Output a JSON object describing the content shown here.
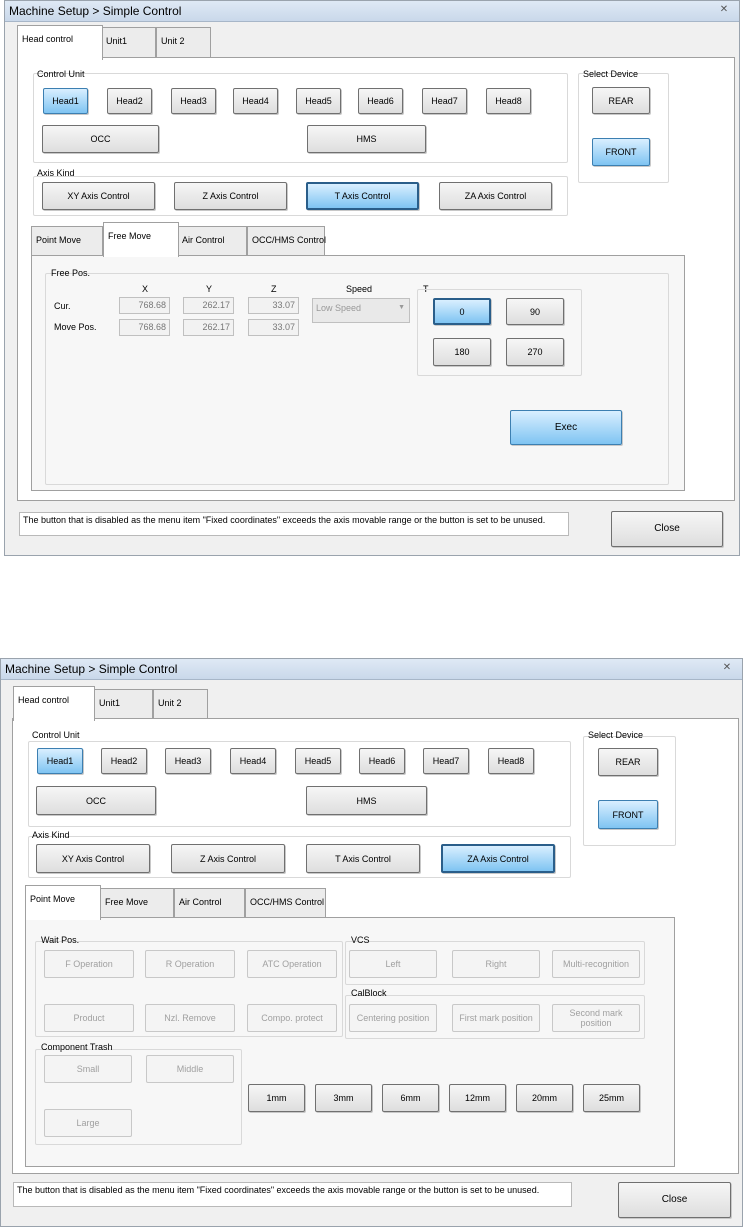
{
  "window1": {
    "title": "Machine Setup > Simple Control",
    "main_tabs": [
      "Head control",
      "Unit1",
      "Unit 2"
    ],
    "control_unit": {
      "label": "Control Unit",
      "heads": [
        "Head1",
        "Head2",
        "Head3",
        "Head4",
        "Head5",
        "Head6",
        "Head7",
        "Head8"
      ],
      "occ": "OCC",
      "hms": "HMS"
    },
    "select_device": {
      "label": "Select Device",
      "rear": "REAR",
      "front": "FRONT"
    },
    "axis_kind": {
      "label": "Axis Kind",
      "buttons": [
        "XY Axis Control",
        "Z Axis Control",
        "T Axis Control",
        "ZA Axis Control"
      ],
      "selected": "T Axis Control"
    },
    "sub_tabs": [
      "Point Move",
      "Free Move",
      "Air Control",
      "OCC/HMS Control"
    ],
    "active_sub_tab": "Free Move",
    "free_pos": {
      "label": "Free Pos.",
      "col_x": "X",
      "col_y": "Y",
      "col_z": "Z",
      "col_speed": "Speed",
      "col_t": "T",
      "row_cur": "Cur.",
      "row_move": "Move Pos.",
      "cur_x": "768.68",
      "cur_y": "262.17",
      "cur_z": "33.07",
      "move_x": "768.68",
      "move_y": "262.17",
      "move_z": "33.07",
      "speed": "Low Speed",
      "t_buttons": [
        "0",
        "90",
        "180",
        "270"
      ],
      "t_selected": "0"
    },
    "exec": "Exec",
    "status_text": "The button that is disabled as the menu item \"Fixed coordinates\" exceeds the axis movable range or the button is set to be unused.",
    "close": "Close"
  },
  "window2": {
    "title": "Machine Setup > Simple Control",
    "main_tabs": [
      "Head control",
      "Unit1",
      "Unit 2"
    ],
    "control_unit": {
      "label": "Control Unit",
      "heads": [
        "Head1",
        "Head2",
        "Head3",
        "Head4",
        "Head5",
        "Head6",
        "Head7",
        "Head8"
      ],
      "occ": "OCC",
      "hms": "HMS"
    },
    "select_device": {
      "label": "Select Device",
      "rear": "REAR",
      "front": "FRONT"
    },
    "axis_kind": {
      "label": "Axis Kind",
      "buttons": [
        "XY Axis Control",
        "Z Axis Control",
        "T Axis Control",
        "ZA Axis Control"
      ],
      "selected": "ZA Axis Control"
    },
    "sub_tabs": [
      "Point Move",
      "Free Move",
      "Air Control",
      "OCC/HMS Control"
    ],
    "active_sub_tab": "Point Move",
    "wait_pos": {
      "label": "Wait Pos.",
      "buttons": [
        "F Operation",
        "R Operation",
        "ATC Operation",
        "Product",
        "Nzl. Remove",
        "Compo. protect"
      ]
    },
    "vcs": {
      "label": "VCS",
      "buttons": [
        "Left",
        "Right",
        "Multi-recognition"
      ]
    },
    "calblock": {
      "label": "CalBlock",
      "buttons": [
        "Centering position",
        "First mark position",
        "Second mark position"
      ]
    },
    "component_trash": {
      "label": "Component Trash",
      "buttons": [
        "Small",
        "Middle",
        "Large"
      ]
    },
    "steps": [
      "1mm",
      "3mm",
      "6mm",
      "12mm",
      "20mm",
      "25mm"
    ],
    "status_text": "The button that is disabled as the menu item \"Fixed coordinates\" exceeds the axis movable range or the button is set to be unused.",
    "close": "Close"
  }
}
